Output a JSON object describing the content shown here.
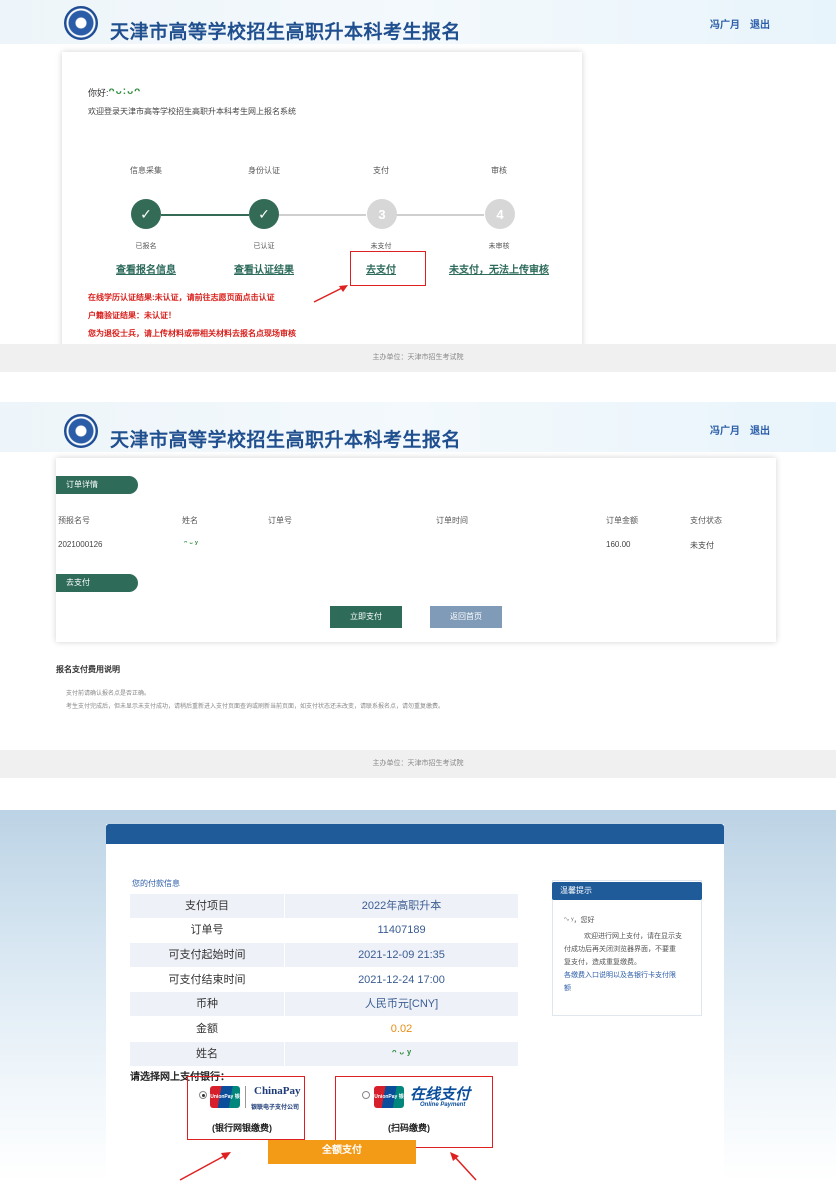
{
  "panel1": {
    "site_title": "天津市高等学校招生高职升本科考生报名",
    "user_name": "冯广月",
    "logout": "退出",
    "greeting": "你好:",
    "greeting_name": "ᴖᴗ:ᴗᴖ",
    "welcome": "欢迎登录天津市高等学校招生高职升本科考生网上报名系统",
    "steps": [
      {
        "title": "信息采集",
        "number": "✓",
        "status": "已报名",
        "link": "查看报名信息"
      },
      {
        "title": "身份认证",
        "number": "✓",
        "status": "已认证",
        "link": "查看认证结果"
      },
      {
        "title": "支付",
        "number": "3",
        "status": "未支付",
        "link": "去支付"
      },
      {
        "title": "审核",
        "number": "4",
        "status": "未审核",
        "link": "未支付，无法上传审核"
      }
    ],
    "warnings": [
      "在线学历认证结果:未认证，请前往志愿页面点击认证",
      "户籍验证结果：未认证！",
      "您为退役士兵，请上传材料或带相关材料去报名点现场审核"
    ],
    "footer": "主办单位：天津市招生考试院"
  },
  "panel2": {
    "site_title": "天津市高等学校招生高职升本科考生报名",
    "user_name": "冯广月",
    "logout": "退出",
    "order_section": "订单详情",
    "headers": [
      "预报名号",
      "姓名",
      "订单号",
      "订单时间",
      "订单金额",
      "支付状态"
    ],
    "row": {
      "reg_no": "2021000126",
      "name": "ᵔ ᵕ ʸ",
      "order_no": "",
      "order_time": "",
      "amount": "160.00",
      "status": "未支付"
    },
    "pay_section": "去支付",
    "pay_now": "立即支付",
    "back_home": "返回首页",
    "note_title": "报名支付费用说明",
    "note_lines": [
      "支付前请确认报名点是否正确。",
      "考生支付完成后，但未显示未支付成功，请稍后重新进入支付页面查询或刷新当前页面，如支付状态还未改变，请联系报名点，请勿重复缴费。"
    ],
    "footer": "主办单位：天津市招生考试院"
  },
  "panel3": {
    "info_title": "您的付款信息",
    "rows": [
      {
        "k": "支付项目",
        "v": "2022年高职升本"
      },
      {
        "k": "订单号",
        "v": "11407189"
      },
      {
        "k": "可支付起始时间",
        "v": "2021-12-09 21:35"
      },
      {
        "k": "可支付结束时间",
        "v": "2021-12-24 17:00"
      },
      {
        "k": "币种",
        "v": "人民币元[CNY]"
      },
      {
        "k": "金额",
        "v": "0.02"
      },
      {
        "k": "姓名",
        "v": "ᵔ ᵕ ʸ"
      }
    ],
    "side_title": "温馨提示",
    "side_hello": "ᵔᵕ ʸ，您好",
    "side_lines": [
      "欢迎进行网上支付，请在显示支",
      "付成功后再关闭浏览器界面，不要重",
      "复支付，造成重复缴费。"
    ],
    "side_link": [
      "各缴费入口说明以及各银行卡支付限",
      "额"
    ],
    "choose_bank": "请选择网上支付银行：",
    "unionpay_text": "UnionPay 银联",
    "chinapay_mark": "ChinaPay",
    "chinapay_sub": "银联电子支付公司",
    "option1_label": "(银行网银缴费)",
    "online_pay": "在线支付",
    "online_pay_en": "Online Payment",
    "option2_label": "(扫码缴费)",
    "confirm": "全额支付",
    "colors": {
      "brand": "#1f5a99",
      "green": "#2e6b58",
      "warn": "#d9201c",
      "orange": "#f39a16"
    }
  }
}
